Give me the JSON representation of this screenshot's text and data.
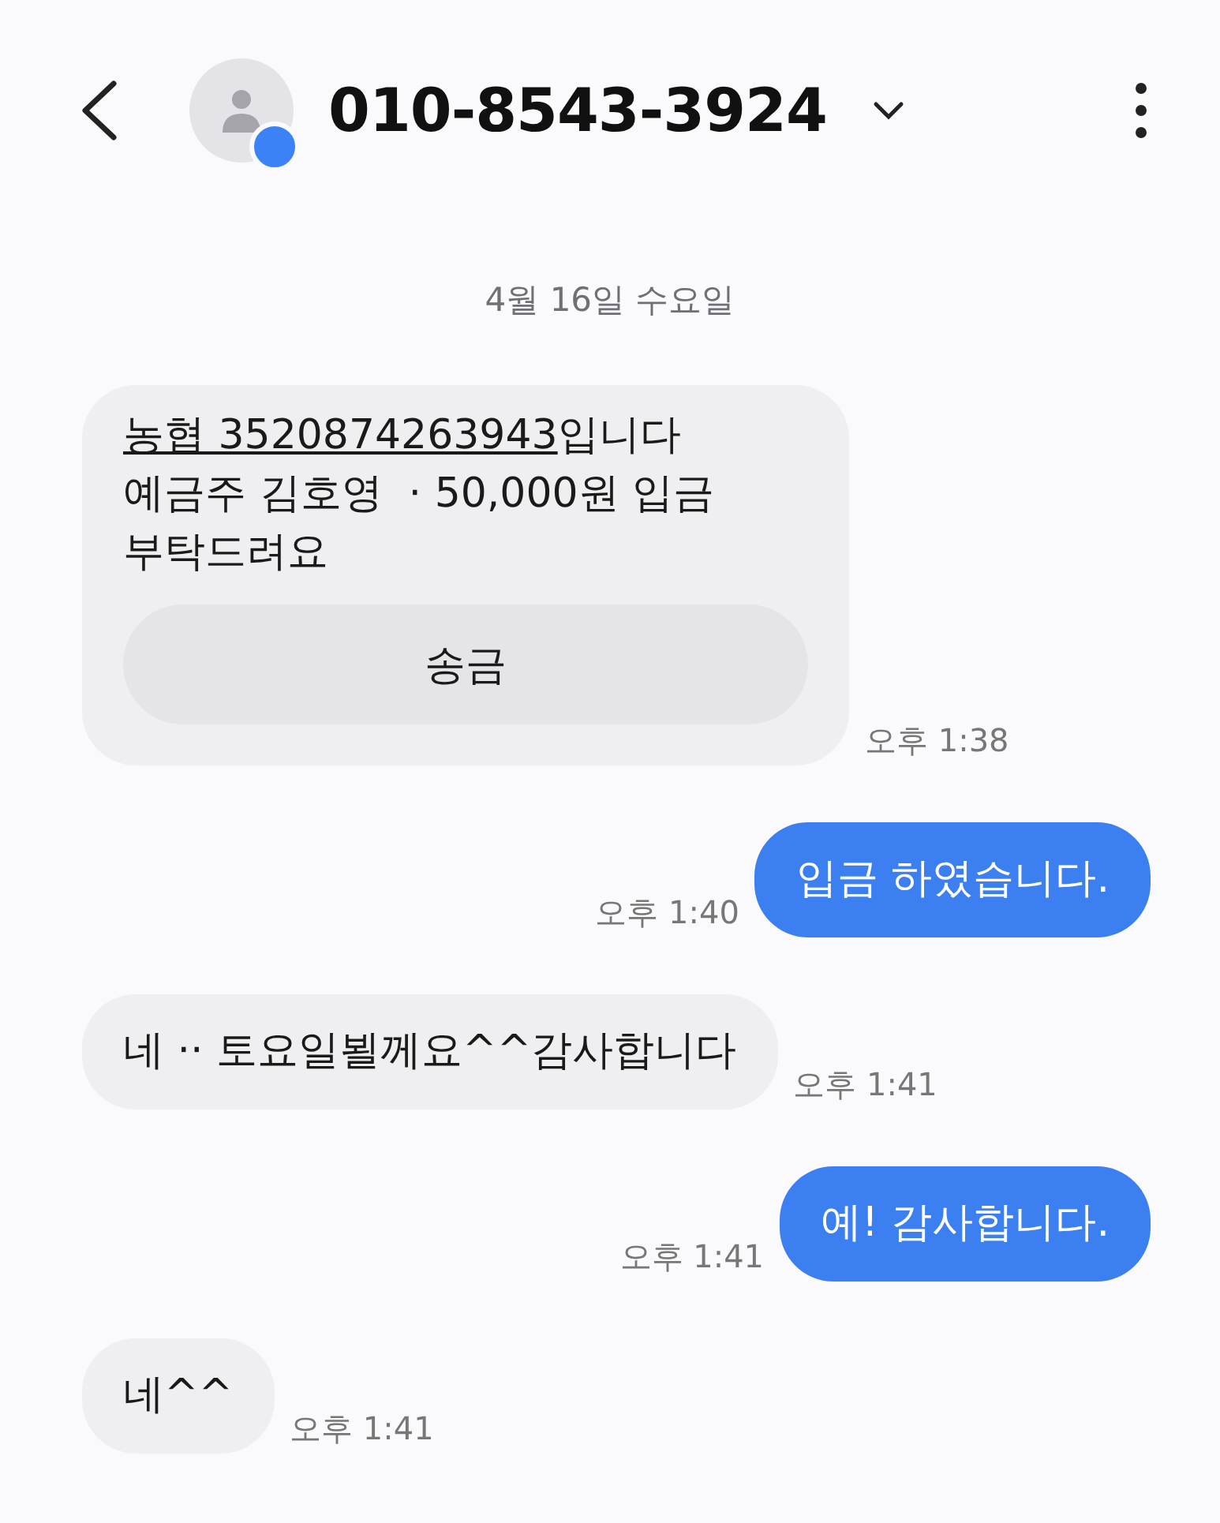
{
  "header": {
    "title": "010-8543-3924",
    "has_badge": true
  },
  "date_divider": "4월 16일 수요일",
  "messages": [
    {
      "kind": "incoming",
      "link": "농협 3520874263943",
      "text": "입니다\n예금주 김호영  · 50,000원 입금\n부탁드려요",
      "button": "송금",
      "time": "오후 1:38"
    },
    {
      "kind": "outgoing",
      "text": "입금 하였습니다.",
      "time": "오후 1:40"
    },
    {
      "kind": "incoming",
      "text": "네 ·· 토요일뵐께요^^감사합니다",
      "time": "오후 1:41"
    },
    {
      "kind": "outgoing",
      "text": "예! 감사합니다.",
      "time": "오후 1:41"
    },
    {
      "kind": "incoming",
      "text": "네^^",
      "time": "오후 1:41"
    }
  ]
}
